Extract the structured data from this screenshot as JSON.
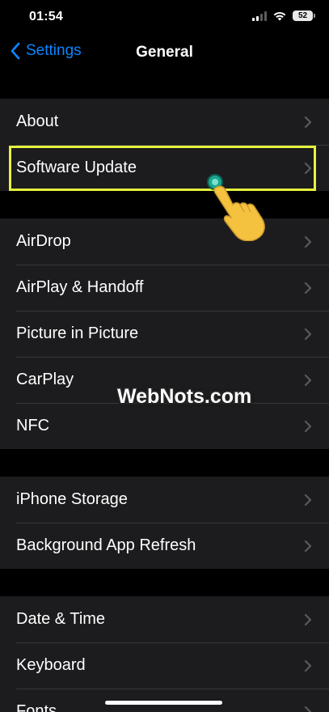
{
  "status_bar": {
    "time": "01:54",
    "battery": "52"
  },
  "nav": {
    "back_label": "Settings",
    "title": "General"
  },
  "groups": [
    {
      "items": [
        {
          "label": "About"
        },
        {
          "label": "Software Update"
        }
      ]
    },
    {
      "items": [
        {
          "label": "AirDrop"
        },
        {
          "label": "AirPlay & Handoff"
        },
        {
          "label": "Picture in Picture"
        },
        {
          "label": "CarPlay"
        },
        {
          "label": "NFC"
        }
      ]
    },
    {
      "items": [
        {
          "label": "iPhone Storage"
        },
        {
          "label": "Background App Refresh"
        }
      ]
    },
    {
      "items": [
        {
          "label": "Date & Time"
        },
        {
          "label": "Keyboard"
        },
        {
          "label": "Fonts"
        }
      ]
    }
  ],
  "watermark": "WebNots.com",
  "colors": {
    "accent": "#0a84ff",
    "highlight": "#e6f23c",
    "row_bg": "#1c1c1e",
    "page_bg": "#000000"
  },
  "icons": {
    "back": "chevron-left-icon",
    "disclosure": "chevron-right-icon"
  }
}
